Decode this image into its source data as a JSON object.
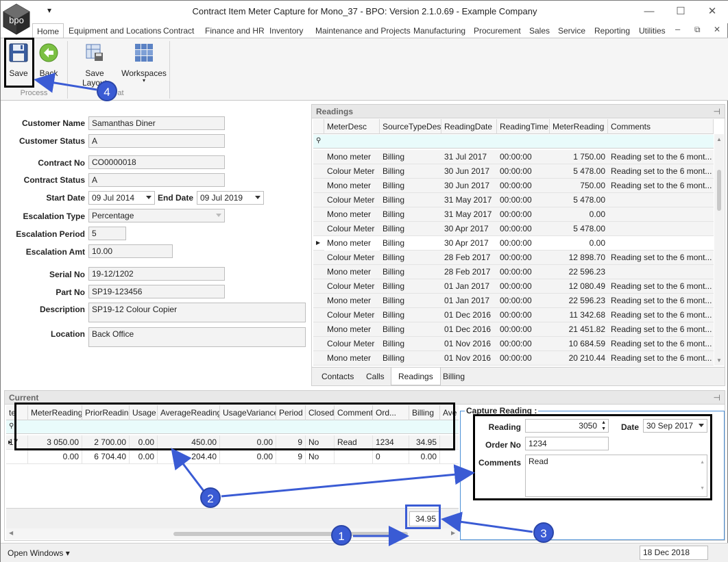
{
  "window": {
    "title": "Contract Item Meter Capture for Mono_37 - BPO: Version 2.1.0.69 - Example Company",
    "logo_text": "bpo",
    "qat_glyph": "▾",
    "min_glyph": "—",
    "max_glyph": "☐",
    "close_glyph": "✕"
  },
  "ribbon": {
    "tabs": [
      "Home",
      "Equipment and Locations",
      "Contract",
      "Finance and HR",
      "Inventory",
      "Maintenance and Projects",
      "Manufacturing",
      "Procurement",
      "Sales",
      "Service",
      "Reporting",
      "Utilities"
    ],
    "active_tab": "Home",
    "buttons": {
      "save": "Save",
      "back": "Back",
      "save_layout": "Save Layout",
      "workspaces": "Workspaces"
    },
    "groups": {
      "process": "Process",
      "format": "at"
    },
    "mdi_min": "–",
    "mdi_restore": "⧉",
    "mdi_close": "✕"
  },
  "form": {
    "customer_name": {
      "label": "Customer Name",
      "value": "Samanthas Diner"
    },
    "customer_status": {
      "label": "Customer Status",
      "value": "A"
    },
    "contract_no": {
      "label": "Contract No",
      "value": "CO0000018"
    },
    "contract_status": {
      "label": "Contract Status",
      "value": "A"
    },
    "start_date": {
      "label": "Start Date",
      "value": "09 Jul 2014"
    },
    "end_date": {
      "label": "End Date",
      "value": "09 Jul 2019"
    },
    "escalation_type": {
      "label": "Escalation Type",
      "value": "Percentage"
    },
    "escalation_period": {
      "label": "Escalation Period",
      "value": "5"
    },
    "escalation_amt": {
      "label": "Escalation Amt",
      "value": "10.00"
    },
    "serial_no": {
      "label": "Serial No",
      "value": "19-12/1202"
    },
    "part_no": {
      "label": "Part No",
      "value": "SP19-123456"
    },
    "description": {
      "label": "Description",
      "value": "SP19-12 Colour Copier"
    },
    "location": {
      "label": "Location",
      "value": "Back Office"
    }
  },
  "readings": {
    "title": "Readings",
    "pin": "⊣",
    "columns": [
      "MeterDesc",
      "SourceTypeDesc",
      "ReadingDate",
      "ReadingTime",
      "MeterReading",
      "Comments"
    ],
    "rows": [
      [
        "Mono meter",
        "Billing",
        "31 Jul 2017",
        "00:00:00",
        "1 750.00",
        "Reading set to the 6 mont..."
      ],
      [
        "Colour Meter",
        "Billing",
        "30 Jun 2017",
        "00:00:00",
        "5 478.00",
        "Reading set to the 6 mont..."
      ],
      [
        "Mono meter",
        "Billing",
        "30 Jun 2017",
        "00:00:00",
        "750.00",
        "Reading set to the 6 mont..."
      ],
      [
        "Colour Meter",
        "Billing",
        "31 May 2017",
        "00:00:00",
        "5 478.00",
        ""
      ],
      [
        "Mono meter",
        "Billing",
        "31 May 2017",
        "00:00:00",
        "0.00",
        ""
      ],
      [
        "Colour Meter",
        "Billing",
        "30 Apr 2017",
        "00:00:00",
        "5 478.00",
        ""
      ],
      [
        "Mono meter",
        "Billing",
        "30 Apr 2017",
        "00:00:00",
        "0.00",
        ""
      ],
      [
        "Colour Meter",
        "Billing",
        "28 Feb 2017",
        "00:00:00",
        "12 898.70",
        "Reading set to the 6 mont..."
      ],
      [
        "Mono meter",
        "Billing",
        "28 Feb 2017",
        "00:00:00",
        "22 596.23",
        ""
      ],
      [
        "Colour Meter",
        "Billing",
        "01 Jan 2017",
        "00:00:00",
        "12 080.49",
        "Reading set to the 6 mont..."
      ],
      [
        "Mono meter",
        "Billing",
        "01 Jan 2017",
        "00:00:00",
        "22 596.23",
        "Reading set to the 6 mont..."
      ],
      [
        "Colour Meter",
        "Billing",
        "01 Dec 2016",
        "00:00:00",
        "11 342.68",
        "Reading set to the 6 mont..."
      ],
      [
        "Mono meter",
        "Billing",
        "01 Dec 2016",
        "00:00:00",
        "21 451.82",
        "Reading set to the 6 mont..."
      ],
      [
        "Colour Meter",
        "Billing",
        "01 Nov 2016",
        "00:00:00",
        "10 684.59",
        "Reading set to the 6 mont..."
      ],
      [
        "Mono meter",
        "Billing",
        "01 Nov 2016",
        "00:00:00",
        "20 210.44",
        "Reading set to the 6 mont..."
      ]
    ],
    "tabs": [
      "Contacts",
      "Calls",
      "Readings",
      "Billing"
    ],
    "active_tab": "Readings"
  },
  "current": {
    "title": "Current",
    "pin": "⊣",
    "columns": [
      "te",
      "MeterReading",
      "PriorReading",
      "Usage",
      "AverageReading",
      "UsageVariance",
      "Period",
      "Closed",
      "Comments",
      "Ord...",
      "Billing",
      "Ave"
    ],
    "rows": [
      [
        "17",
        "3 050.00",
        "2 700.00",
        "0.00",
        "450.00",
        "0.00",
        "9",
        "No",
        "Read",
        "1234",
        "34.95",
        ""
      ],
      [
        "",
        "0.00",
        "6 704.40",
        "0.00",
        "204.40",
        "0.00",
        "9",
        "No",
        "",
        "0",
        "0.00",
        ""
      ]
    ],
    "total_billing": "34.95"
  },
  "capture": {
    "title": "Capture Reading :",
    "reading_label": "Reading",
    "reading_value": "3050",
    "date_label": "Date",
    "date_value": "30 Sep 2017",
    "order_label": "Order No",
    "order_value": "1234",
    "comments_label": "Comments",
    "comments_value": "Read"
  },
  "statusbar": {
    "open_windows": "Open Windows ▾",
    "date": "18 Dec 2018"
  },
  "annotations": {
    "b1": "1",
    "b2": "2",
    "b3": "3",
    "b4": "4",
    "accent": "#3a5bd4"
  }
}
